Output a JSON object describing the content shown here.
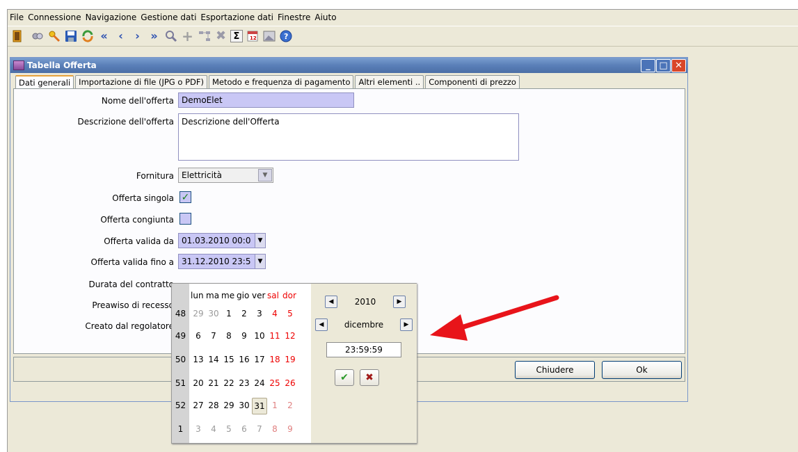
{
  "menu": [
    "File",
    "Connessione",
    "Navigazione",
    "Gestione dati",
    "Esportazione dati",
    "Finestre",
    "Aiuto"
  ],
  "window": {
    "title": "Tabella Offerta"
  },
  "tabs": [
    "Dati generali",
    "Importazione di file (JPG o PDF)",
    "Metodo e frequenza di pagamento",
    "Altri elementi ..",
    "Componenti di prezzo"
  ],
  "form": {
    "nome_label": "Nome dell'offerta",
    "nome_value": "DemoElet",
    "descr_label": "Descrizione dell'offerta",
    "descr_value": "Descrizione dell'Offerta",
    "fornitura_label": "Fornitura",
    "fornitura_value": "Elettricità",
    "singola_label": "Offerta singola",
    "singola_checked": true,
    "congiunta_label": "Offerta congiunta",
    "congiunta_checked": false,
    "valida_da_label": "Offerta valida da",
    "valida_da_value": "01.03.2010 00:0",
    "valida_fino_label": "Offerta valida fino a",
    "valida_fino_value": "31.12.2010 23:5",
    "durata_label": "Durata del contratto",
    "preavviso_label": "Preawiso di recesso",
    "creato_label": "Creato dal regolatore"
  },
  "buttons": {
    "chiudere": "Chiudere",
    "ok": "Ok"
  },
  "calendar": {
    "day_headers": [
      "lun",
      "ma",
      "me",
      "gio",
      "ver",
      "sal",
      "dor"
    ],
    "year": "2010",
    "month": "dicembre",
    "time": "23:59:59",
    "confirm_icon": "check-icon",
    "cancel_icon": "x-icon",
    "weeks": [
      {
        "wk": "48",
        "days": [
          "29",
          "30",
          "1",
          "2",
          "3",
          "4",
          "5"
        ]
      },
      {
        "wk": "49",
        "days": [
          "6",
          "7",
          "8",
          "9",
          "10",
          "11",
          "12"
        ]
      },
      {
        "wk": "50",
        "days": [
          "13",
          "14",
          "15",
          "16",
          "17",
          "18",
          "19"
        ]
      },
      {
        "wk": "51",
        "days": [
          "20",
          "21",
          "22",
          "23",
          "24",
          "25",
          "26"
        ]
      },
      {
        "wk": "52",
        "days": [
          "27",
          "28",
          "29",
          "30",
          "31",
          "1",
          "2"
        ]
      },
      {
        "wk": "1",
        "days": [
          "3",
          "4",
          "5",
          "6",
          "7",
          "8",
          "9"
        ]
      }
    ]
  },
  "colors": {
    "arrow": "#e8141a",
    "field_bg": "#c9c7f5",
    "titlebar": "#5a7fb8"
  }
}
